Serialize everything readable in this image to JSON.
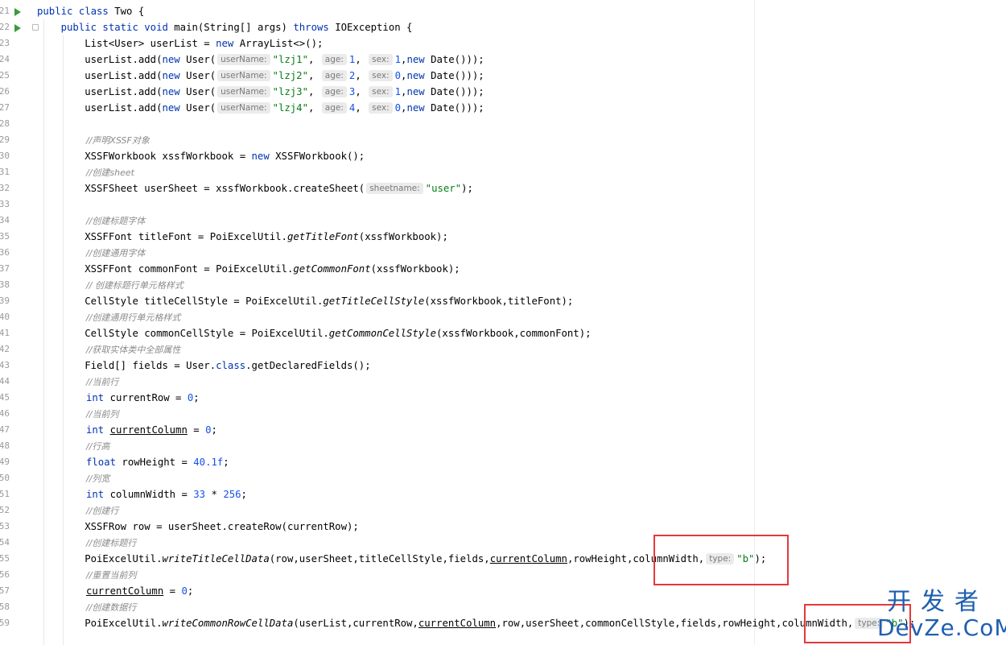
{
  "gutter": {
    "line_numbers": [
      "21",
      "22",
      "23",
      "24",
      "25",
      "26",
      "27",
      "28",
      "29",
      "30",
      "31",
      "32",
      "33",
      "34",
      "35",
      "36",
      "37",
      "38",
      "39",
      "40",
      "41",
      "42",
      "43",
      "44",
      "45",
      "46",
      "47",
      "48",
      "49",
      "50",
      "51",
      "52",
      "53",
      "54",
      "55",
      "56",
      "57",
      "58",
      "59"
    ]
  },
  "code": {
    "l1": {
      "a": "public class ",
      "b": "Two {"
    },
    "l2": {
      "a": "    public static void ",
      "b": "main",
      "c": "(String[] args) ",
      "d": "throws ",
      "e": "IOException {"
    },
    "l3": {
      "a": "        List<User> userList = ",
      "b": "new ",
      "c": "ArrayList<>();"
    },
    "users": [
      {
        "pre": "        userList.add(",
        "nw": "new ",
        "user": "User(",
        "h1": "userName:",
        "s": "\"lzj1\"",
        ",": ", ",
        "h2": "age:",
        "n1": "1",
        ",2": ", ",
        "h3": "sex:",
        "n2": "1",
        ",3": ",",
        "nw2": "new ",
        "end": "Date()));"
      },
      {
        "pre": "        userList.add(",
        "nw": "new ",
        "user": "User(",
        "h1": "userName:",
        "s": "\"lzj2\"",
        ",": ", ",
        "h2": "age:",
        "n1": "2",
        ",2": ", ",
        "h3": "sex:",
        "n2": "0",
        ",3": ",",
        "nw2": "new ",
        "end": "Date()));"
      },
      {
        "pre": "        userList.add(",
        "nw": "new ",
        "user": "User(",
        "h1": "userName:",
        "s": "\"lzj3\"",
        ",": ", ",
        "h2": "age:",
        "n1": "3",
        ",2": ", ",
        "h3": "sex:",
        "n2": "1",
        ",3": ",",
        "nw2": "new ",
        "end": "Date()));"
      },
      {
        "pre": "        userList.add(",
        "nw": "new ",
        "user": "User(",
        "h1": "userName:",
        "s": "\"lzj4\"",
        ",": ", ",
        "h2": "age:",
        "n1": "4",
        ",2": ", ",
        "h3": "sex:",
        "n2": "0",
        ",3": ",",
        "nw2": "new ",
        "end": "Date()));"
      }
    ],
    "c_declare_xssf": "//声明XSSF对象",
    "l_wb_a": "        XSSFWorkbook xssfWorkbook = ",
    "l_wb_new": "new ",
    "l_wb_b": "XSSFWorkbook();",
    "c_create_sheet": "//创建sheet",
    "l_sheet_a": "        XSSFSheet userSheet = xssfWorkbook.createSheet(",
    "h_sheetname": "sheetname:",
    "l_sheet_str": "\"user\"",
    "l_sheet_end": ");",
    "c_title_font": "//创建标题字体",
    "l_tf_a": "        XSSFFont titleFont = PoiExcelUtil.",
    "l_tf_m": "getTitleFont",
    "l_tf_b": "(xssfWorkbook);",
    "c_common_font": "//创建通用字体",
    "l_cf_a": "        XSSFFont commonFont = PoiExcelUtil.",
    "l_cf_m": "getCommonFont",
    "l_cf_b": "(xssfWorkbook);",
    "c_title_style": "// 创建标题行单元格样式",
    "l_ts_a": "        CellStyle titleCellStyle = PoiExcelUtil.",
    "l_ts_m": "getTitleCellStyle",
    "l_ts_b": "(xssfWorkbook,titleFont);",
    "c_common_style": "//创建通用行单元格样式",
    "l_cs_a": "        CellStyle commonCellStyle = PoiExcelUtil.",
    "l_cs_m": "getCommonCellStyle",
    "l_cs_b": "(xssfWorkbook,commonFont);",
    "c_fields": "//获取实体类中全部属性",
    "l_f_a": "        Field[] fields = User.",
    "l_f_kw": "class",
    "l_f_b": ".getDeclaredFields();",
    "c_cur_row": "//当前行",
    "l_cr_kw": "int ",
    "l_cr_a": "currentRow = ",
    "l_cr_n": "0",
    "l_cr_e": ";",
    "c_cur_col": "//当前列",
    "l_cc_kw": "int ",
    "l_cc_v": "currentColumn",
    "l_cc_a": " = ",
    "l_cc_n": "0",
    "l_cc_e": ";",
    "c_row_h": "//行高",
    "l_rh_kw": "float ",
    "l_rh_a": "rowHeight = ",
    "l_rh_n": "40.1f",
    "l_rh_e": ";",
    "c_col_w": "//列宽",
    "l_cw_kw": "int ",
    "l_cw_a": "columnWidth = ",
    "l_cw_n1": "33",
    "l_cw_m": " * ",
    "l_cw_n2": "256",
    "l_cw_e": ";",
    "c_create_row": "//创建行",
    "l_row": "        XSSFRow row = userSheet.createRow(currentRow);",
    "c_title_row": "//创建标题行",
    "l_wt_a": "        PoiExcelUtil.",
    "l_wt_m": "writeTitleCellData",
    "l_wt_b": "(row,userSheet,titleCellStyle,fields,",
    "l_wt_v": "currentColumn",
    "l_wt_c": ",rowHeight,columnWidth,",
    "h_type1": "type:",
    "l_wt_s": "\"b\"",
    "l_wt_e": ");",
    "c_reset_col": "//重置当前列",
    "l_rc_v": "currentColumn",
    "l_rc_a": " = ",
    "l_rc_n": "0",
    "l_rc_e": ";",
    "c_data_row": "//创建数据行",
    "l_wc_a": "        PoiExcelUtil.",
    "l_wc_m": "writeCommonRowCellData",
    "l_wc_b": "(userList,currentRow,",
    "l_wc_v": "currentColumn",
    "l_wc_c": ",row,userSheet,commonCellStyle,fields,rowHeight,columnWidth,",
    "h_type2": "type:",
    "l_wc_s": "\"b\"",
    "l_wc_e": ");"
  },
  "watermark": {
    "top": "开发者",
    "bottom": "DevZe.CoM"
  },
  "colors": {
    "keyword": "#0033b3",
    "number": "#1750eb",
    "string": "#067d17",
    "comment": "#8c8c8c",
    "highlight": "#e5383b",
    "watermark": "#1f5fb0"
  }
}
